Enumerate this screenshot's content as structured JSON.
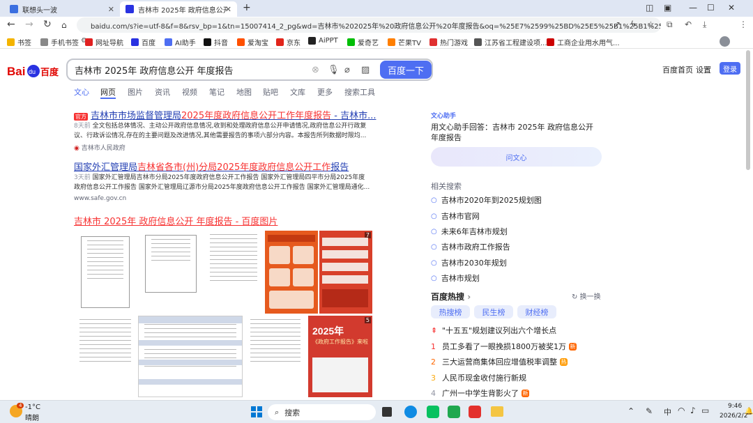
{
  "tabs": [
    {
      "label": "联想头一波",
      "active": false
    },
    {
      "label": "吉林市 2025年 政府信息公开 年",
      "active": true
    }
  ],
  "url": "baidu.com/s?ie=utf-8&f=8&rsv_bp=1&tn=15007414_2_pg&wd=吉林市%202025年%20政府信息公开%20年度报告&oq=%25E7%2599%25BD%25E5%25B1%25B1%25E5%25B8%2582%...",
  "bookmarks": [
    "书签",
    "手机书签",
    "网址导航",
    "百度",
    "AI助手",
    "抖音",
    "爱淘宝",
    "京东",
    "AiPPT",
    "爱奇艺",
    "芒果TV",
    "热门游戏",
    "江苏省工程建设项...",
    "工商企业用水用气..."
  ],
  "search": {
    "query": "吉林市 2025年 政府信息公开 年度报告",
    "button": "百度一下"
  },
  "header_links": {
    "home": "百度首页",
    "settings": "设置",
    "login": "登录"
  },
  "vtabs": [
    "文心",
    "网页",
    "图片",
    "资讯",
    "视频",
    "笔记",
    "地图",
    "贴吧",
    "文库",
    "更多",
    "搜索工具"
  ],
  "results": [
    {
      "tag": "官方",
      "title_parts": [
        "吉林市市场监督管理局",
        "2025年度政府信息公开工作年度报告",
        " - 吉林市..."
      ],
      "date": "8天前",
      "abstract": "全文包括总体情况、主动公开政府信息情况,收到和处理政府信息公开申请情况,政府信息公开行政复议、行政诉讼情况,存在的主要问题及改进情况,其他需要报告的事项六部分内容。本报告所列数据时限均...",
      "source": "吉林市人民政府"
    },
    {
      "title_parts": [
        "国家外汇管理局",
        "吉林省各市(州)分局",
        "2025年度政府信息公开工作",
        "报告"
      ],
      "date": "3天前",
      "abstract": "国家外汇管理局吉林市分局2025年度政府信息公开工作报告 国家外汇管理局四平市分局2025年度政府信息公开工作报告 国家外汇管理局辽源市分局2025年度政府信息公开工作报告 国家外汇管理局通化...",
      "source": "www.safe.gov.cn"
    },
    {
      "title": "吉林市 2025年 政府信息公开 年度报告 - 百度图片"
    }
  ],
  "image_texts": {
    "t5_badge": "7",
    "t10_title": "2025年",
    "t10_sub": "《政府工作报告》来啦",
    "t10_badge": "5"
  },
  "right": {
    "ai_label": "文心助手",
    "ai_text": "用文心助手回答：吉林市 2025年 政府信息公开 年度报告",
    "ai_button": "问文心",
    "related_title": "相关搜索",
    "related": [
      "吉林市2020年到2025规划图",
      "吉林市官网",
      "未来6年吉林市规划",
      "吉林市政府工作报告",
      "吉林市2030年规划",
      "吉林市规划"
    ],
    "hot_title": "百度热搜",
    "hot_refresh": "换一换",
    "hot_tabs": [
      "热搜榜",
      "民生榜",
      "财经榜"
    ],
    "hot": [
      {
        "n": "",
        "text": "\"十五五\"规划建议列出六个增长点",
        "badge": "",
        "badge_color": ""
      },
      {
        "n": "1",
        "text": "员工多看了一眼挽损1800万被奖1万",
        "badge": "新",
        "badge_color": "#ff6600"
      },
      {
        "n": "2",
        "text": "三大运营商集体回应增值税率调整",
        "badge": "热",
        "badge_color": "#ff9a00"
      },
      {
        "n": "3",
        "text": "人民币现金收付施行新规",
        "badge": "",
        "badge_color": ""
      },
      {
        "n": "4",
        "text": "广州一中学生背影火了",
        "badge": "新",
        "badge_color": "#ff6600"
      }
    ]
  },
  "taskbar": {
    "weather_temp": "-1°C",
    "weather_desc": "晴朗",
    "weather_badge": "4",
    "search": "搜索",
    "ime": "中",
    "time": "9:46",
    "date": "2026/2/2"
  }
}
